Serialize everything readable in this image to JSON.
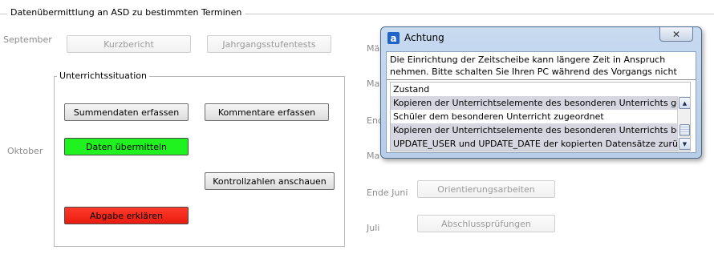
{
  "window": {
    "group_title": "Datenübermittlung an ASD zu bestimmten Terminen"
  },
  "schedule": {
    "september": {
      "label": "September",
      "buttons": [
        "Kurzbericht",
        "Jahrgangsstufentests"
      ]
    },
    "oktober": {
      "label": "Oktober",
      "group_title": "Unterrichtssituation",
      "buttons": {
        "summendaten": "Summendaten erfassen",
        "kommentare": "Kommentare erfassen",
        "uebermitteln": "Daten übermitteln",
        "kontrollzahlen": "Kontrollzahlen anschauen",
        "abgabe": "Abgabe erklären"
      },
      "colors": {
        "uebermitteln": "#1ff21f",
        "abgabe": "#ef2a1c"
      }
    },
    "hidden_labels": [
      "Mä",
      "Ma",
      "End",
      "Ma"
    ],
    "ende_juni": {
      "label": "Ende Juni",
      "button": "Orientierungsarbeiten"
    },
    "juli": {
      "label": "Juli",
      "button": "Abschlussprüfungen"
    }
  },
  "dialog": {
    "title": "Achtung",
    "icon": "app-logo-icon",
    "close_label": "✕",
    "message": "Die Einrichtung der Zeitscheibe kann längere Zeit in Anspruch nehmen. Bitte schalten Sie Ihren PC während des Vorgangs nicht aus.",
    "list_header": "Zustand",
    "top_list_rows": [
      "Kopieren der Unterrichtselemente des besonderen Unterrichts gest...",
      "Schüler dem besonderen Unterricht zugeordnet"
    ],
    "bottom_list_rows": [
      "Kopieren der Unterrichtselemente des besonderen Unterrichts bee...",
      "UPDATE_USER und UPDATE_DATE der kopierten Datensätze zurückg..."
    ]
  }
}
